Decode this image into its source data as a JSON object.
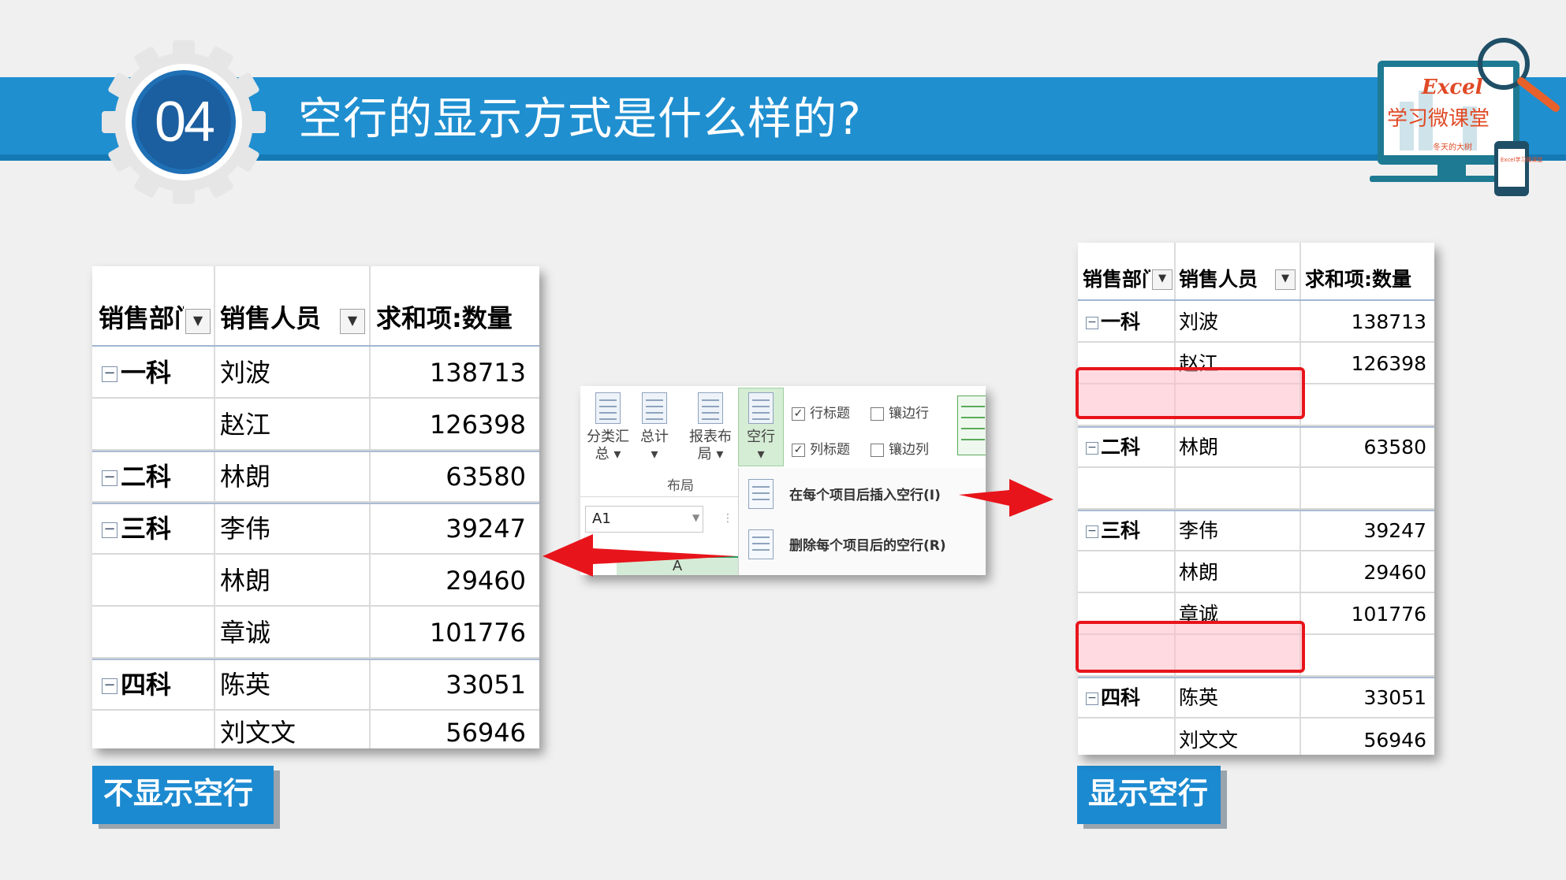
{
  "header": {
    "number": "04",
    "title": "空行的显示方式是什么样的?"
  },
  "logo": {
    "line1": "Excel",
    "line2": "学习微课堂",
    "line3": "冬天的大树",
    "phone_text": "Excel学习微课堂"
  },
  "left_table": {
    "headers": [
      "销售部门",
      "销售人员",
      "求和项:数量"
    ],
    "rows": [
      {
        "dept": "一科",
        "person": "刘波",
        "qty": "138713"
      },
      {
        "dept": "",
        "person": "赵江",
        "qty": "126398"
      },
      {
        "dept": "二科",
        "person": "林朗",
        "qty": "63580"
      },
      {
        "dept": "三科",
        "person": "李伟",
        "qty": "39247"
      },
      {
        "dept": "",
        "person": "林朗",
        "qty": "29460"
      },
      {
        "dept": "",
        "person": "章诚",
        "qty": "101776"
      },
      {
        "dept": "四科",
        "person": "陈英",
        "qty": "33051"
      },
      {
        "dept": "",
        "person": "刘文文",
        "qty": "56946"
      }
    ],
    "label": "不显示空行"
  },
  "right_table": {
    "headers": [
      "销售部门",
      "销售人员",
      "求和项:数量"
    ],
    "rows": [
      {
        "dept": "一科",
        "person": "刘波",
        "qty": "138713"
      },
      {
        "dept": "",
        "person": "赵江",
        "qty": "126398"
      },
      {
        "dept": "",
        "person": "",
        "qty": ""
      },
      {
        "dept": "二科",
        "person": "林朗",
        "qty": "63580"
      },
      {
        "dept": "",
        "person": "",
        "qty": ""
      },
      {
        "dept": "三科",
        "person": "李伟",
        "qty": "39247"
      },
      {
        "dept": "",
        "person": "林朗",
        "qty": "29460"
      },
      {
        "dept": "",
        "person": "章诚",
        "qty": "101776"
      },
      {
        "dept": "",
        "person": "",
        "qty": ""
      },
      {
        "dept": "四科",
        "person": "陈英",
        "qty": "33051"
      },
      {
        "dept": "",
        "person": "刘文文",
        "qty": "56946"
      }
    ],
    "label": "显示空行"
  },
  "ribbon": {
    "btn_subtotal": [
      "分类汇",
      "总"
    ],
    "btn_total": "总计",
    "btn_layout": [
      "报表布",
      "局"
    ],
    "btn_blank": "空行",
    "cb_row_headers": "行标题",
    "cb_banded_rows": "镶边行",
    "cb_col_headers": "列标题",
    "cb_banded_cols": "镶边列",
    "group_label": "布局",
    "name_box": "A1",
    "menu_insert": "在每个项目后插入空行(I)",
    "menu_remove": "删除每个项目后的空行(R)",
    "column_header": "A"
  },
  "colors": {
    "banner": "#1f8fd0",
    "arrow": "#e8141b",
    "highlight": "#e8141b",
    "tag": "#1c8ad0"
  }
}
